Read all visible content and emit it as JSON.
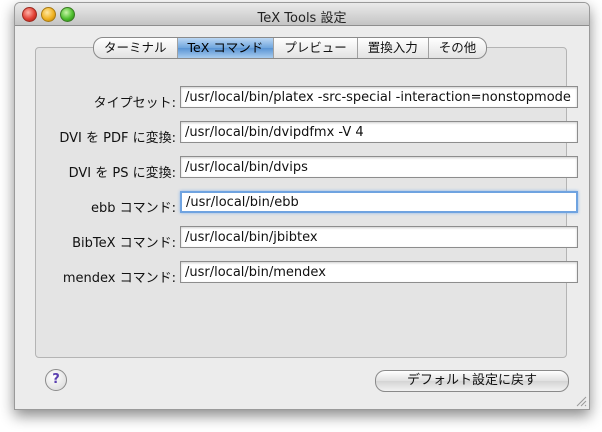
{
  "window": {
    "title": "TeX Tools 設定"
  },
  "tabs": [
    {
      "label": "ターミナル",
      "active": false
    },
    {
      "label": "TeX コマンド",
      "active": true
    },
    {
      "label": "プレビュー",
      "active": false
    },
    {
      "label": "置換入力",
      "active": false
    },
    {
      "label": "その他",
      "active": false
    }
  ],
  "fields": [
    {
      "label": "タイプセット:",
      "value": "/usr/local/bin/platex -src-special -interaction=nonstopmode"
    },
    {
      "label": "DVI を PDF に変換:",
      "value": "/usr/local/bin/dvipdfmx -V 4"
    },
    {
      "label": "DVI を PS に変換:",
      "value": "/usr/local/bin/dvips"
    },
    {
      "label": "ebb コマンド:",
      "value": "/usr/local/bin/ebb"
    },
    {
      "label": "BibTeX コマンド:",
      "value": "/usr/local/bin/jbibtex"
    },
    {
      "label": "mendex コマンド:",
      "value": "/usr/local/bin/mendex"
    }
  ],
  "buttons": {
    "help": "?",
    "restore": "デフォルト設定に戻す"
  },
  "icons": {
    "close": "close-button-icon",
    "minimize": "minimize-button-icon",
    "zoom": "zoom-button-icon",
    "resize": "resize-grip-icon"
  }
}
